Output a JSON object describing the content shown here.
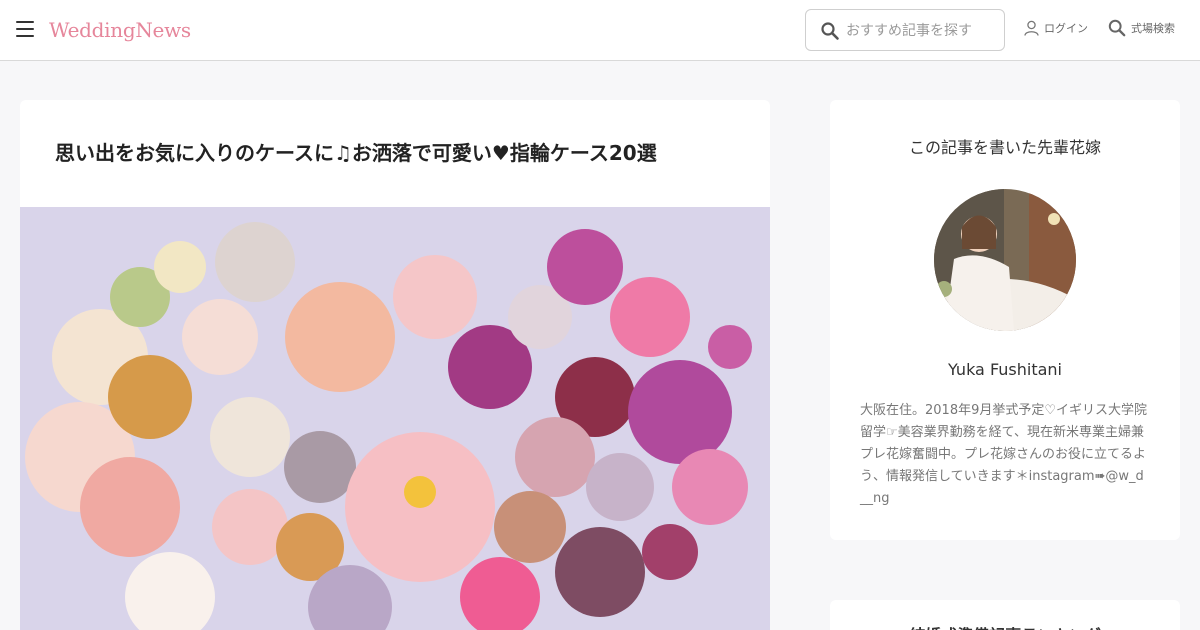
{
  "header": {
    "logo": "WeddingNews",
    "search_placeholder": "おすすめ記事を探す",
    "login_label": "ログイン",
    "venue_search_label": "式場検索",
    "icons": [
      "menu-icon",
      "search-icon",
      "user-icon",
      "search-icon"
    ]
  },
  "article": {
    "title": "思い出をお気に入りのケースに♫お洒落で可愛い♥指輪ケース20選"
  },
  "author_card": {
    "heading": "この記事を書いた先輩花嫁",
    "name": "Yuka Fushitani",
    "bio": "大阪在住。2018年9月挙式予定♡イギリス大学院留学☞美容業界勤務を経て、現在新米専業主婦兼プレ花嫁奮闘中。プレ花嫁さんのお役に立てるよう、情報発信していきます＊instagram➠@w_d__ng"
  },
  "ranking_card": {
    "title": "結婚式準備記事ランキング"
  },
  "colors": {
    "logo": "#e6869b",
    "background": "#f7f7f9",
    "card": "#ffffff"
  }
}
